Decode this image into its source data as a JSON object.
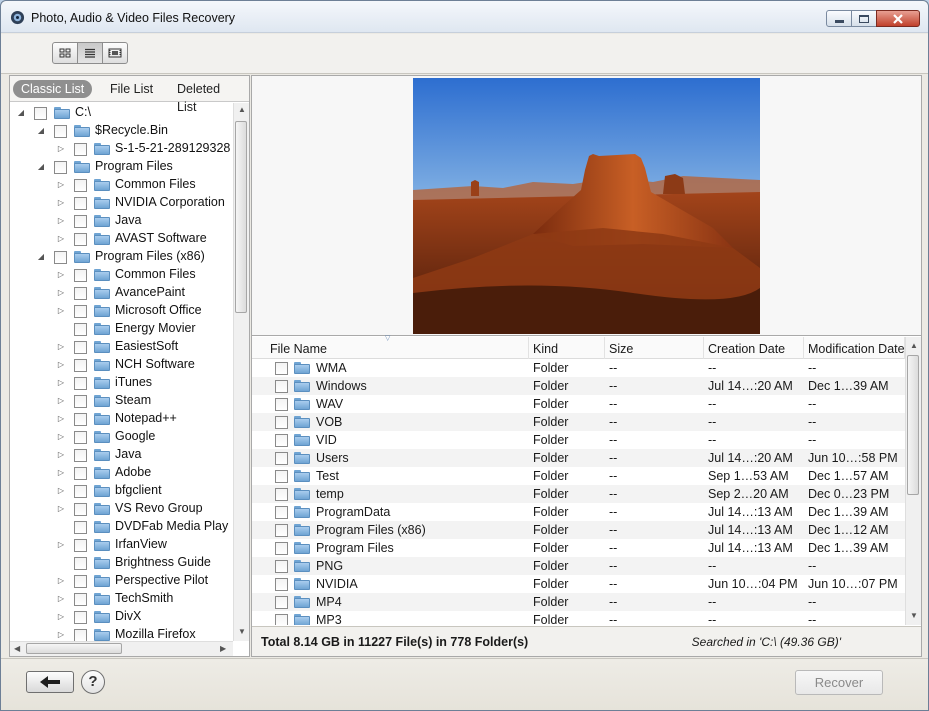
{
  "window": {
    "title": "Photo, Audio & Video Files Recovery"
  },
  "toolbar": {
    "view_modes": [
      "thumbnails-view",
      "list-view",
      "filmstrip-view"
    ],
    "active_view": "list-view"
  },
  "left_tabs": [
    {
      "label": "Classic List",
      "active": true
    },
    {
      "label": "File List",
      "active": false
    },
    {
      "label": "Deleted List",
      "active": false
    }
  ],
  "tree": [
    {
      "label": "C:\\",
      "level": 0,
      "expanded": true
    },
    {
      "label": "$Recycle.Bin",
      "level": 1,
      "expanded": true
    },
    {
      "label": "S-1-5-21-289129328",
      "level": 2,
      "expanded": false
    },
    {
      "label": "Program Files",
      "level": 1,
      "expanded": true
    },
    {
      "label": "Common Files",
      "level": 2,
      "expanded": false
    },
    {
      "label": "NVIDIA Corporation",
      "level": 2,
      "expanded": false
    },
    {
      "label": "Java",
      "level": 2,
      "expanded": false
    },
    {
      "label": "AVAST Software",
      "level": 2,
      "expanded": false
    },
    {
      "label": "Program Files (x86)",
      "level": 1,
      "expanded": true
    },
    {
      "label": "Common Files",
      "level": 2,
      "expanded": false
    },
    {
      "label": "AvancePaint",
      "level": 2,
      "expanded": false
    },
    {
      "label": "Microsoft Office",
      "level": 2,
      "expanded": false
    },
    {
      "label": "Energy Movier",
      "level": 2,
      "leaf": true
    },
    {
      "label": "EasiestSoft",
      "level": 2,
      "expanded": false
    },
    {
      "label": "NCH Software",
      "level": 2,
      "expanded": false
    },
    {
      "label": "iTunes",
      "level": 2,
      "expanded": false
    },
    {
      "label": "Steam",
      "level": 2,
      "expanded": false
    },
    {
      "label": "Notepad++",
      "level": 2,
      "expanded": false
    },
    {
      "label": "Google",
      "level": 2,
      "expanded": false
    },
    {
      "label": "Java",
      "level": 2,
      "expanded": false
    },
    {
      "label": "Adobe",
      "level": 2,
      "expanded": false
    },
    {
      "label": "bfgclient",
      "level": 2,
      "expanded": false
    },
    {
      "label": "VS Revo Group",
      "level": 2,
      "expanded": false
    },
    {
      "label": "DVDFab Media Play",
      "level": 2,
      "leaf": true
    },
    {
      "label": "IrfanView",
      "level": 2,
      "expanded": false
    },
    {
      "label": "Brightness Guide",
      "level": 2,
      "leaf": true
    },
    {
      "label": "Perspective Pilot",
      "level": 2,
      "expanded": false
    },
    {
      "label": "TechSmith",
      "level": 2,
      "expanded": false
    },
    {
      "label": "DivX",
      "level": 2,
      "expanded": false
    },
    {
      "label": "Mozilla Firefox",
      "level": 2,
      "expanded": false
    }
  ],
  "file_list": {
    "columns": [
      "File Name",
      "Kind",
      "Size",
      "Creation Date",
      "Modification Date"
    ],
    "rows": [
      {
        "name": "WMA",
        "kind": "Folder",
        "size": "--",
        "created": "--",
        "modified": "--"
      },
      {
        "name": "Windows",
        "kind": "Folder",
        "size": "--",
        "created": "Jul 14…:20 AM",
        "modified": "Dec 1…39 AM"
      },
      {
        "name": "WAV",
        "kind": "Folder",
        "size": "--",
        "created": "--",
        "modified": "--"
      },
      {
        "name": "VOB",
        "kind": "Folder",
        "size": "--",
        "created": "--",
        "modified": "--"
      },
      {
        "name": "VID",
        "kind": "Folder",
        "size": "--",
        "created": "--",
        "modified": "--"
      },
      {
        "name": "Users",
        "kind": "Folder",
        "size": "--",
        "created": "Jul 14…:20 AM",
        "modified": "Jun 10…:58 PM"
      },
      {
        "name": "Test",
        "kind": "Folder",
        "size": "--",
        "created": "Sep 1…53 AM",
        "modified": "Dec 1…57 AM"
      },
      {
        "name": "temp",
        "kind": "Folder",
        "size": "--",
        "created": "Sep 2…20 AM",
        "modified": "Dec 0…23 PM"
      },
      {
        "name": "ProgramData",
        "kind": "Folder",
        "size": "--",
        "created": "Jul 14…:13 AM",
        "modified": "Dec 1…39 AM"
      },
      {
        "name": "Program Files (x86)",
        "kind": "Folder",
        "size": "--",
        "created": "Jul 14…:13 AM",
        "modified": "Dec 1…12 AM"
      },
      {
        "name": "Program Files",
        "kind": "Folder",
        "size": "--",
        "created": "Jul 14…:13 AM",
        "modified": "Dec 1…39 AM"
      },
      {
        "name": "PNG",
        "kind": "Folder",
        "size": "--",
        "created": "--",
        "modified": "--"
      },
      {
        "name": "NVIDIA",
        "kind": "Folder",
        "size": "--",
        "created": "Jun 10…:04 PM",
        "modified": "Jun 10…:07 PM"
      },
      {
        "name": "MP4",
        "kind": "Folder",
        "size": "--",
        "created": "--",
        "modified": "--"
      },
      {
        "name": "MP3",
        "kind": "Folder",
        "size": "--",
        "created": "--",
        "modified": "--"
      }
    ]
  },
  "status": {
    "total": "Total 8.14 GB in 11227 File(s) in 778 Folder(s)",
    "searched": "Searched in 'C:\\ (49.36 GB)'"
  },
  "footer": {
    "help_label": "?",
    "recover_label": "Recover",
    "recover_enabled": false
  },
  "colors": {
    "folder": "#6fa4d3",
    "selected_header": "#d7ebfa",
    "close_button": "#c0402b"
  }
}
